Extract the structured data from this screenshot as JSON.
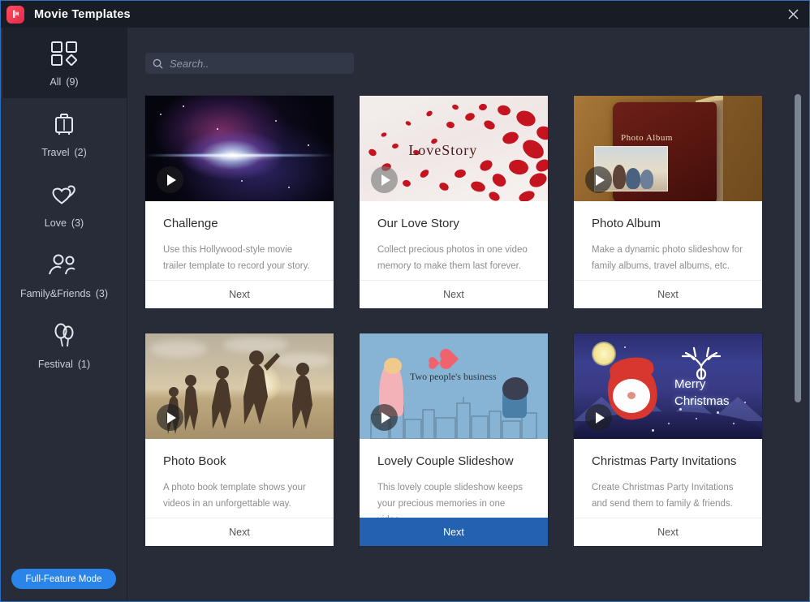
{
  "window": {
    "title": "Movie Templates",
    "logo_icon": "app-logo-icon",
    "close_icon": "close-icon"
  },
  "sidebar": {
    "items": [
      {
        "id": "all",
        "label": "All",
        "count": "(9)",
        "icon": "grid-icon",
        "active": true
      },
      {
        "id": "travel",
        "label": "Travel",
        "count": "(2)",
        "icon": "suitcase-icon",
        "active": false
      },
      {
        "id": "love",
        "label": "Love",
        "count": "(3)",
        "icon": "hearts-icon",
        "active": false
      },
      {
        "id": "family-friends",
        "label": "Family&Friends",
        "count": "(3)",
        "icon": "people-icon",
        "active": false
      },
      {
        "id": "festival",
        "label": "Festival",
        "count": "(1)",
        "icon": "balloons-icon",
        "active": false
      }
    ],
    "full_feature_button": "Full-Feature Mode"
  },
  "search": {
    "placeholder": "Search..",
    "value": "",
    "icon": "search-icon"
  },
  "templates": [
    {
      "id": "challenge",
      "title": "Challenge",
      "description": "Use this Hollywood-style movie trailer template to record your story.",
      "next_label": "Next",
      "next_highlighted": false,
      "thumbnail_art": "space-nebula",
      "thumbnail_caption": "",
      "play_icon": "play-icon",
      "play_style": "dark"
    },
    {
      "id": "our-love-story",
      "title": "Our Love Story",
      "description": "Collect precious photos in one video memory to make them last forever.",
      "next_label": "Next",
      "next_highlighted": false,
      "thumbnail_art": "rose-petals",
      "thumbnail_caption": "LoveStory",
      "play_icon": "play-icon",
      "play_style": "light"
    },
    {
      "id": "photo-album",
      "title": "Photo Album",
      "description": "Make a dynamic photo slideshow for family albums, travel albums, etc.",
      "next_label": "Next",
      "next_highlighted": false,
      "thumbnail_art": "leather-album",
      "thumbnail_caption": "Photo Album",
      "play_icon": "play-icon",
      "play_style": "dark"
    },
    {
      "id": "photo-book",
      "title": "Photo Book",
      "description": "A photo book template shows your videos in an unforgettable way.",
      "next_label": "Next",
      "next_highlighted": false,
      "thumbnail_art": "beach-runners",
      "thumbnail_caption": "",
      "play_icon": "play-icon",
      "play_style": "dark"
    },
    {
      "id": "lovely-couple-slideshow",
      "title": "Lovely Couple Slideshow",
      "description": "This lovely couple slideshow keeps your precious memories in one video.",
      "next_label": "Next",
      "next_highlighted": true,
      "thumbnail_art": "cartoon-couple",
      "thumbnail_caption": "Two people's business",
      "play_icon": "play-icon",
      "play_style": "dark"
    },
    {
      "id": "christmas-party-invitations",
      "title": "Christmas Party Invitations",
      "description": "Create Christmas Party Invitations and send them to family & friends.",
      "next_label": "Next",
      "next_highlighted": false,
      "thumbnail_art": "christmas-santa",
      "thumbnail_caption": "Merry Christmas",
      "play_icon": "play-icon",
      "play_style": "dark"
    }
  ],
  "scrollbar": {
    "name": "content-scrollbar"
  },
  "colors": {
    "window_bg": "#262b38",
    "titlebar_bg": "#181c25",
    "sidebar_bg": "#272c38",
    "sidebar_active_bg": "#1d212b",
    "accent_blue": "#2a84ea",
    "next_highlight_blue": "#2461ae",
    "logo_red": "#e3294a",
    "card_bg": "#ffffff",
    "window_border": "#2f6fbf"
  }
}
